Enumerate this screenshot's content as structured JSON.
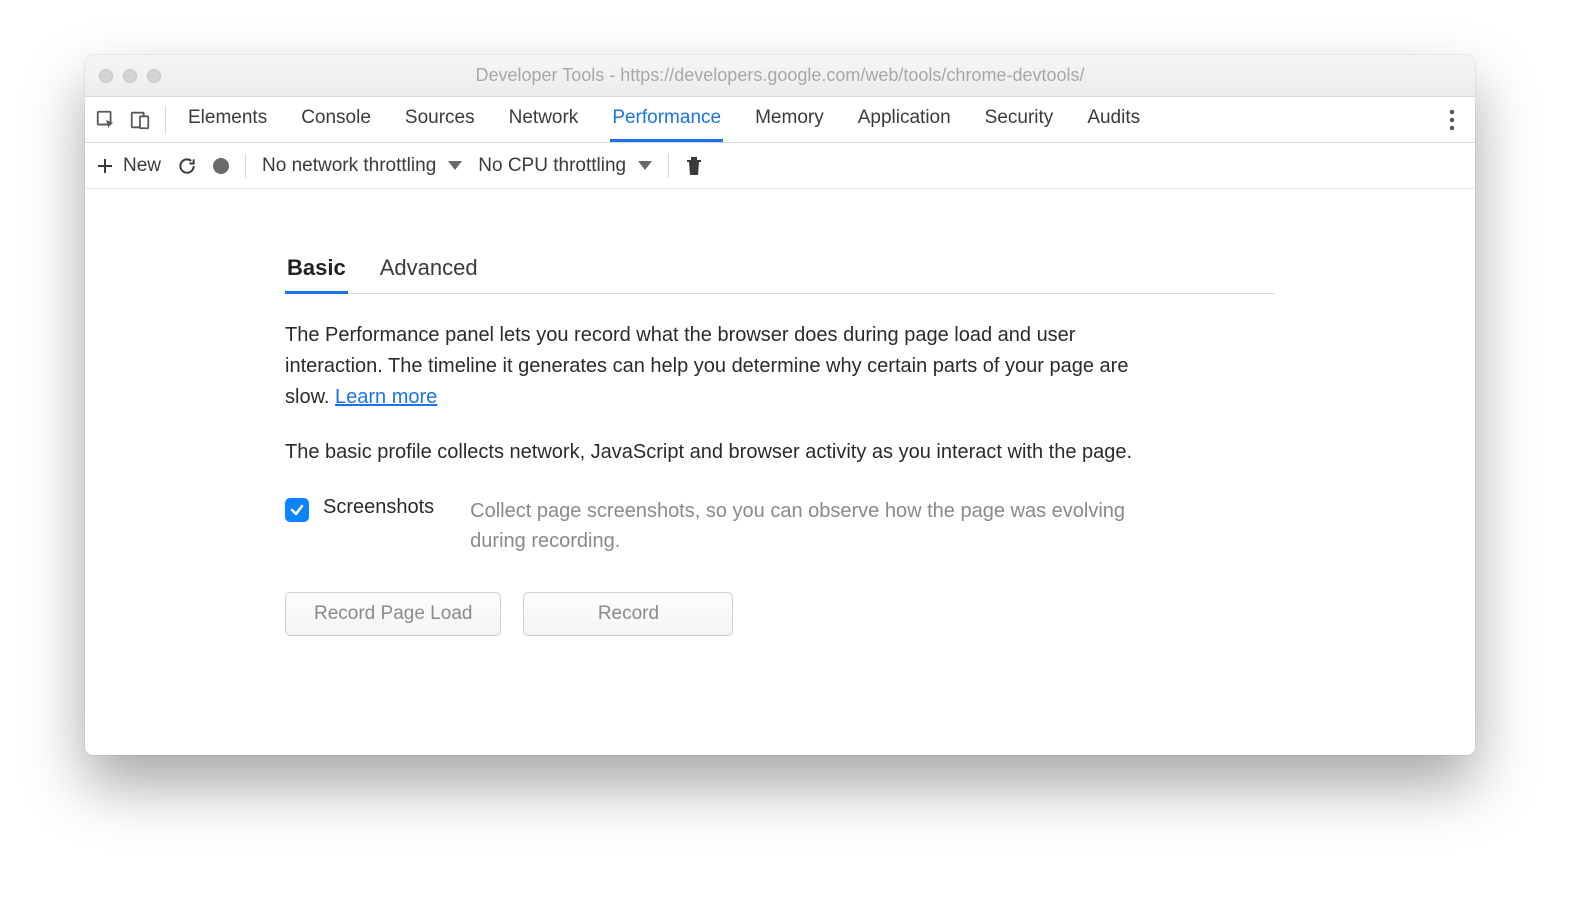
{
  "window": {
    "title": "Developer Tools - https://developers.google.com/web/tools/chrome-devtools/"
  },
  "tabs": {
    "items": [
      "Elements",
      "Console",
      "Sources",
      "Network",
      "Performance",
      "Memory",
      "Application",
      "Security",
      "Audits"
    ],
    "active": "Performance"
  },
  "toolbar": {
    "new_label": "New",
    "network_throttle": "No network throttling",
    "cpu_throttle": "No CPU throttling"
  },
  "panel": {
    "subtabs": {
      "basic": "Basic",
      "advanced": "Advanced",
      "active": "Basic"
    },
    "intro": "The Performance panel lets you record what the browser does during page load and user interaction. The timeline it generates can help you determine why certain parts of your page are slow.  ",
    "learn_more": "Learn more",
    "basic_desc": "The basic profile collects network, JavaScript and browser activity as you interact with the page.",
    "screenshots": {
      "label": "Screenshots",
      "desc": "Collect page screenshots, so you can observe how the page was evolving during recording.",
      "checked": true
    },
    "buttons": {
      "record_page_load": "Record Page Load",
      "record": "Record"
    }
  }
}
